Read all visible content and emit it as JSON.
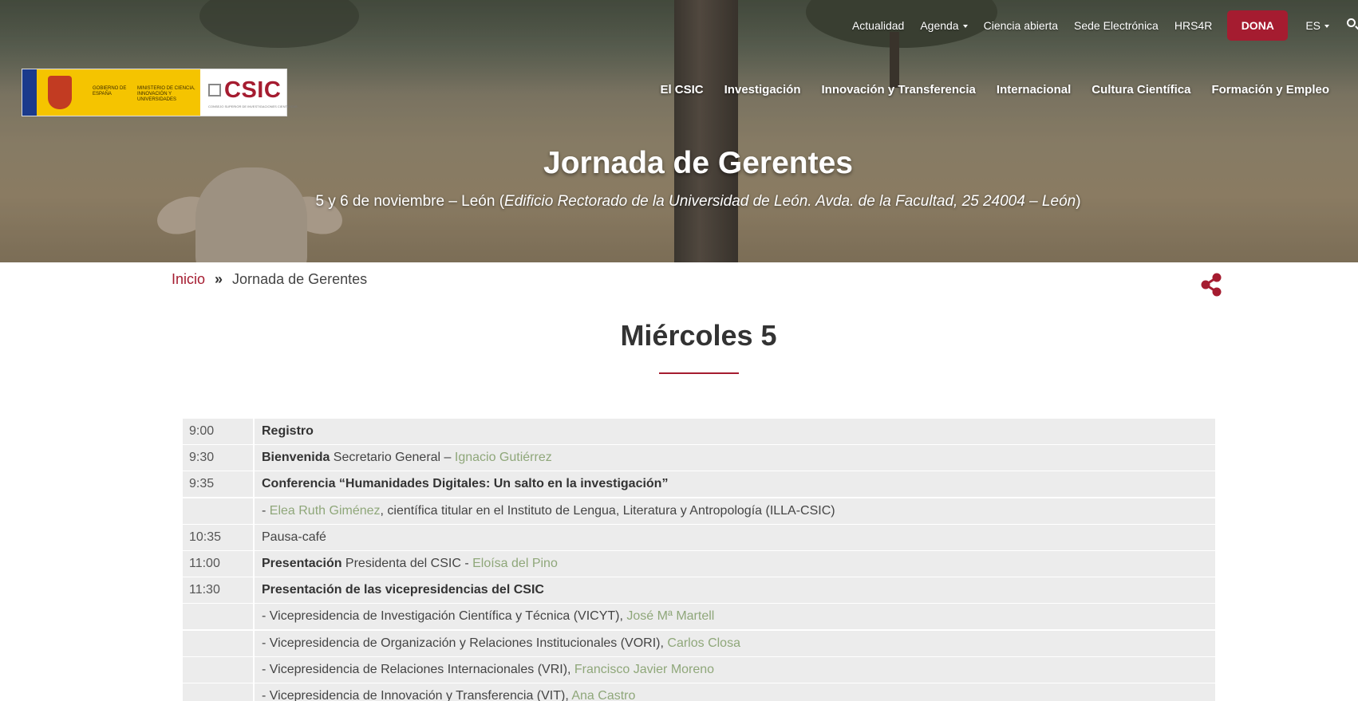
{
  "topnav": {
    "items": [
      "Actualidad",
      "Agenda",
      "Ciencia abierta",
      "Sede Electrónica",
      "HRS4R"
    ],
    "dona": "DONA",
    "lang": "ES"
  },
  "logo": {
    "gov_text": "GOBIERNO DE ESPAÑA",
    "ministry_text": "MINISTERIO DE CIENCIA, INNOVACIÓN Y UNIVERSIDADES",
    "csic": "CSIC",
    "csic_sub": "CONSEJO SUPERIOR DE INVESTIGACIONES CIENTÍFICAS"
  },
  "mainnav": [
    "El CSIC",
    "Investigación",
    "Innovación y Transferencia",
    "Internacional",
    "Cultura Científica",
    "Formación y Empleo"
  ],
  "hero": {
    "title": "Jornada de Gerentes",
    "subtitle_plain": "5 y 6 de noviembre – León (",
    "subtitle_italic": "Edificio Rectorado de la Universidad de León. Avda. de la Facultad, 25 24004 – León",
    "subtitle_end": ")"
  },
  "breadcrumb": {
    "home": "Inicio",
    "sep": "»",
    "current": "Jornada de Gerentes"
  },
  "day": {
    "title": "Miércoles 5"
  },
  "agenda": [
    {
      "time": "9:00",
      "bold": "Registro",
      "text": "",
      "link": "",
      "after": ""
    },
    {
      "time": "9:30",
      "bold": "Bienvenida",
      "text": " Secretario General – ",
      "link": "Ignacio Gutiérrez",
      "after": ""
    },
    {
      "time": "9:35",
      "bold": "Conferencia “Humanidades Digitales: Un salto en la investigación”",
      "text": "",
      "link": "",
      "after": ""
    },
    {
      "time": "",
      "bold": "",
      "text": "- ",
      "link": "Elea Ruth Giménez",
      "after": ", científica titular en el Instituto de Lengua, Literatura y Antropología (ILLA-CSIC)"
    },
    {
      "time": "10:35",
      "bold": "",
      "text": "Pausa-café",
      "link": "",
      "after": ""
    },
    {
      "time": "11:00",
      "bold": "Presentación",
      "text": " Presidenta del CSIC - ",
      "link": "Eloísa del Pino",
      "after": ""
    },
    {
      "time": "11:30",
      "bold": "Presentación de las vicepresidencias del CSIC",
      "text": "",
      "link": "",
      "after": ""
    },
    {
      "time": "",
      "bold": "",
      "text": "- Vicepresidencia de Investigación Científica y Técnica (VICYT),  ",
      "link": "José Mª Martell",
      "after": ""
    },
    {
      "time": "",
      "bold": "",
      "text": "- Vicepresidencia de Organización y Relaciones Institucionales (VORI), ",
      "link": "Carlos Closa",
      "after": ""
    },
    {
      "time": "",
      "bold": "",
      "text": "- Vicepresidencia de Relaciones Internacionales (VRI), ",
      "link": "Francisco Javier Moreno",
      "after": ""
    },
    {
      "time": "",
      "bold": "",
      "text": "- Vicepresidencia de Innovación y Transferencia (VIT), ",
      "link": "Ana Castro",
      "after": ""
    }
  ]
}
